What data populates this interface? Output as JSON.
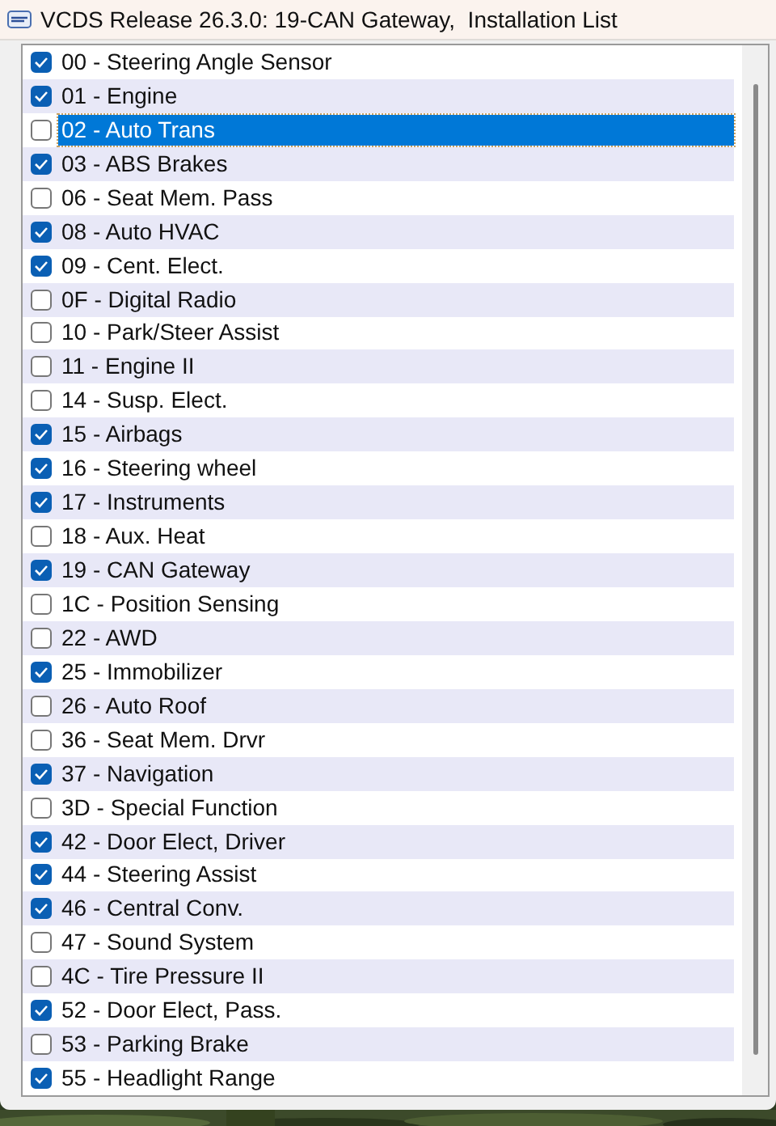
{
  "window": {
    "title": "VCDS Release 26.3.0: 19-CAN Gateway,  Installation List"
  },
  "items": [
    {
      "label": "00 - Steering Angle Sensor",
      "checked": true,
      "selected": false
    },
    {
      "label": "01 - Engine",
      "checked": true,
      "selected": false
    },
    {
      "label": "02 - Auto Trans",
      "checked": false,
      "selected": true
    },
    {
      "label": "03 - ABS Brakes",
      "checked": true,
      "selected": false
    },
    {
      "label": "06 - Seat Mem. Pass",
      "checked": false,
      "selected": false
    },
    {
      "label": "08 - Auto HVAC",
      "checked": true,
      "selected": false
    },
    {
      "label": "09 - Cent. Elect.",
      "checked": true,
      "selected": false
    },
    {
      "label": "0F - Digital Radio",
      "checked": false,
      "selected": false
    },
    {
      "label": "10 - Park/Steer Assist",
      "checked": false,
      "selected": false
    },
    {
      "label": "11 - Engine II",
      "checked": false,
      "selected": false
    },
    {
      "label": "14 - Susp. Elect.",
      "checked": false,
      "selected": false
    },
    {
      "label": "15 - Airbags",
      "checked": true,
      "selected": false
    },
    {
      "label": "16 - Steering wheel",
      "checked": true,
      "selected": false
    },
    {
      "label": "17 - Instruments",
      "checked": true,
      "selected": false
    },
    {
      "label": "18 - Aux. Heat",
      "checked": false,
      "selected": false
    },
    {
      "label": "19 - CAN Gateway",
      "checked": true,
      "selected": false
    },
    {
      "label": "1C - Position Sensing",
      "checked": false,
      "selected": false
    },
    {
      "label": "22 - AWD",
      "checked": false,
      "selected": false
    },
    {
      "label": "25 - Immobilizer",
      "checked": true,
      "selected": false
    },
    {
      "label": "26 - Auto Roof",
      "checked": false,
      "selected": false
    },
    {
      "label": "36 - Seat Mem. Drvr",
      "checked": false,
      "selected": false
    },
    {
      "label": "37 - Navigation",
      "checked": true,
      "selected": false
    },
    {
      "label": "3D - Special Function",
      "checked": false,
      "selected": false
    },
    {
      "label": "42 - Door Elect, Driver",
      "checked": true,
      "selected": false
    },
    {
      "label": "44 - Steering Assist",
      "checked": true,
      "selected": false
    },
    {
      "label": "46 - Central Conv.",
      "checked": true,
      "selected": false
    },
    {
      "label": "47 - Sound System",
      "checked": false,
      "selected": false
    },
    {
      "label": "4C - Tire Pressure II",
      "checked": false,
      "selected": false
    },
    {
      "label": "52 - Door Elect, Pass.",
      "checked": true,
      "selected": false
    },
    {
      "label": "53 - Parking Brake",
      "checked": false,
      "selected": false
    },
    {
      "label": "55 - Headlight Range",
      "checked": true,
      "selected": false
    }
  ]
}
